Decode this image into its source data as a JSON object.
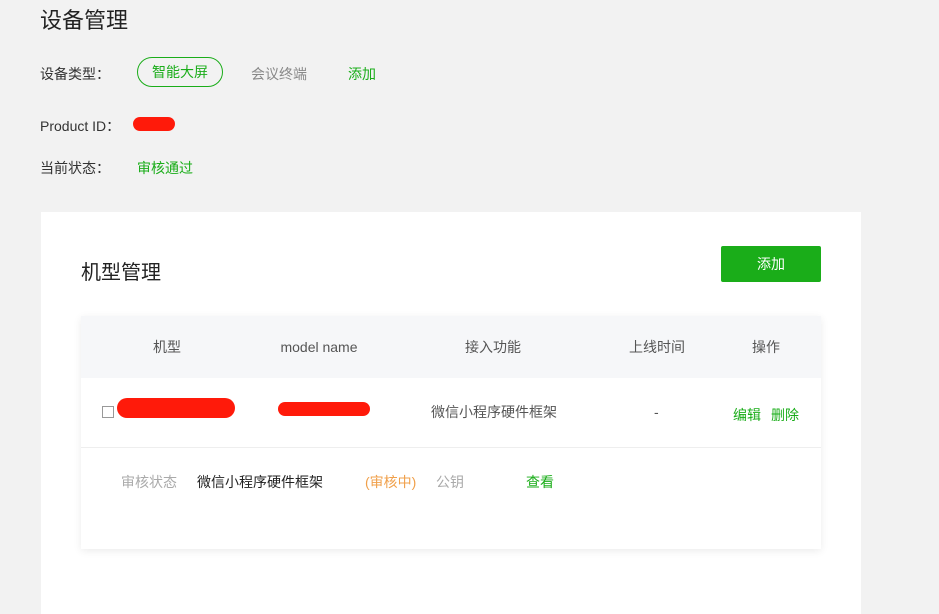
{
  "header": {
    "title": "设备管理",
    "device_type_label": "设备类型：",
    "device_types": [
      "智能大屏",
      "会议终端"
    ],
    "add_link": "添加",
    "product_id_label": "Product ID：",
    "status_label": "当前状态：",
    "status_value": "审核通过"
  },
  "model_mgmt": {
    "title": "机型管理",
    "add_button": "添加",
    "columns": [
      "机型",
      "model name",
      "接入功能",
      "上线时间",
      "操作"
    ],
    "row": {
      "feature": "微信小程序硬件框架",
      "online_time": "-",
      "edit": "编辑",
      "delete": "删除"
    },
    "detail": {
      "review_label": "审核状态",
      "framework": "微信小程序硬件框架",
      "review_status": "(审核中)",
      "public_key_label": "公钥",
      "view_link": "查看"
    }
  },
  "colors": {
    "accent": "#1aad19",
    "pending": "#f0a04b",
    "redaction": "#ff1a0a"
  }
}
